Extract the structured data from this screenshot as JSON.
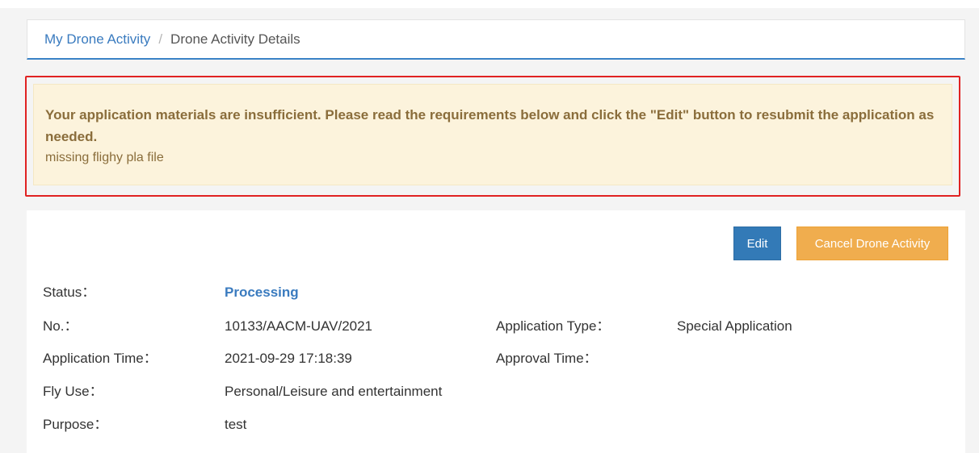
{
  "breadcrumb": {
    "parent": "My Drone Activity",
    "separator": "/",
    "current": "Drone Activity Details"
  },
  "alert": {
    "title": "Your application materials are insufficient. Please read the requirements below and click the \"Edit\" button to resubmit the application as needed.",
    "detail": "missing flighy pla file"
  },
  "actions": {
    "edit_label": "Edit",
    "cancel_label": "Cancel Drone Activity"
  },
  "details": {
    "status_label": "Status：",
    "status_value": "Processing",
    "no_label": "No.：",
    "no_value": "10133/AACM-UAV/2021",
    "app_type_label": "Application Type：",
    "app_type_value": "Special Application",
    "app_time_label": "Application Time：",
    "app_time_value": "2021-09-29 17:18:39",
    "approval_time_label": "Approval Time：",
    "approval_time_value": "",
    "fly_use_label": "Fly Use：",
    "fly_use_value": "Personal/Leisure and entertainment",
    "purpose_label": "Purpose：",
    "purpose_value": "test"
  },
  "colors": {
    "primary": "#337ab7",
    "warning": "#f0ad4e",
    "alert_bg": "#fcf3dc",
    "alert_text": "#8a6d3b",
    "highlight_border": "#e02222"
  }
}
